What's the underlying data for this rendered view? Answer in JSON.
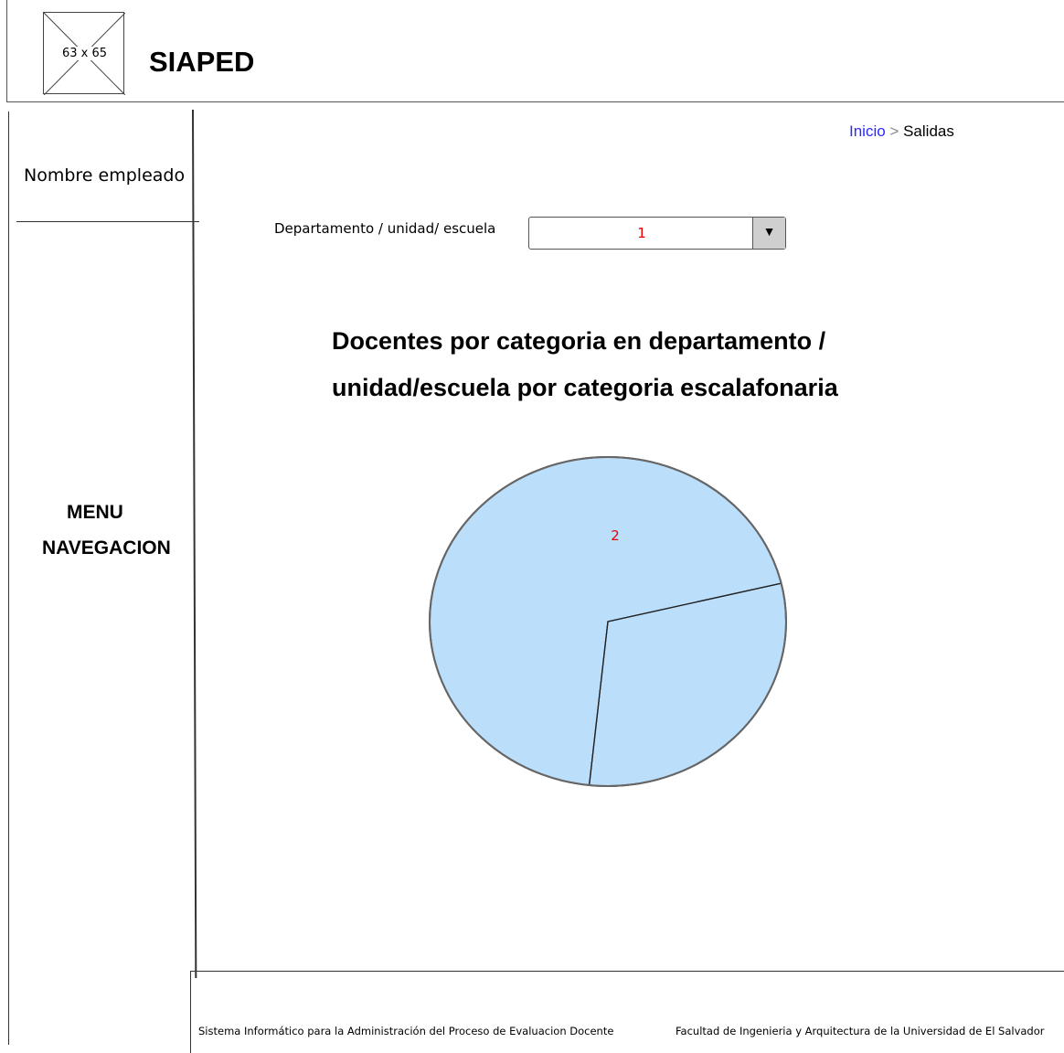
{
  "header": {
    "logo_placeholder": "63 x 65",
    "app_title": "SIAPED"
  },
  "sidebar": {
    "employee_name": "Nombre empleado",
    "menu_line1": "MENU",
    "menu_line2": "NAVEGACION"
  },
  "breadcrumb": {
    "home": "Inicio",
    "separator": ">",
    "current": "Salidas"
  },
  "filter": {
    "label": "Departamento / unidad/ escuela",
    "selected_value": "1"
  },
  "chart_title_line1": "Docentes por categoria en departamento /",
  "chart_title_line2": "unidad/escuela por categoria escalafonaria",
  "chart_data": {
    "type": "pie",
    "annotation": "2",
    "slice_fractions": [
      0.696,
      0.304
    ],
    "fill_color": "#bbdefb",
    "stroke_color": "#666666"
  },
  "footer": {
    "left_text": "Sistema Informático para la Administración del Proceso de Evaluacion Docente",
    "right_text": "Facultad de Ingenieria y Arquitectura de la Universidad de El Salvador"
  }
}
